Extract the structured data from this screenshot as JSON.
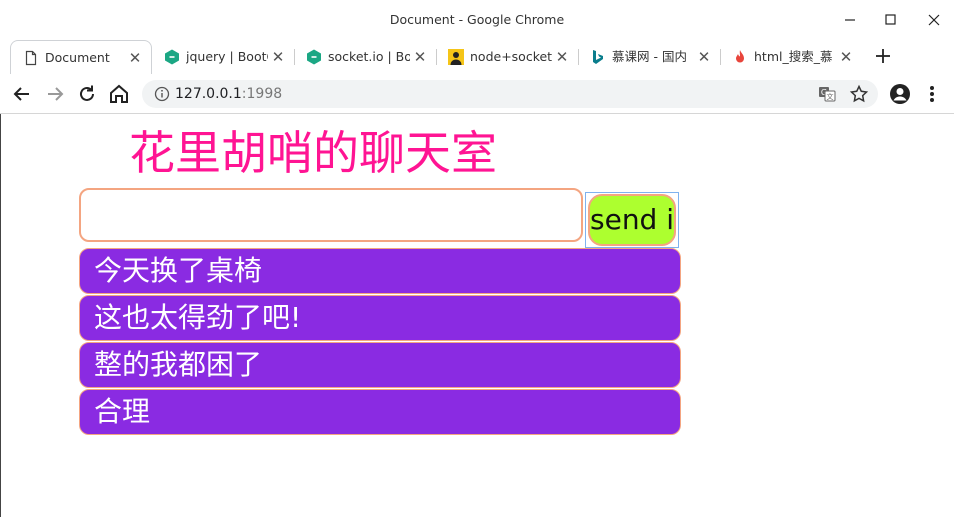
{
  "window": {
    "title": "Document - Google Chrome",
    "controls": [
      "minimize",
      "maximize",
      "close"
    ]
  },
  "tabs": [
    {
      "label": "Document",
      "icon": "document-icon",
      "active": true
    },
    {
      "label": "jquery | BootC",
      "icon": "bootcdn-icon",
      "active": false
    },
    {
      "label": "socket.io | Bo",
      "icon": "bootcdn-icon",
      "active": false
    },
    {
      "label": "node+socket",
      "icon": "avatar-icon",
      "active": false
    },
    {
      "label": "慕课网 - 国内",
      "icon": "bing-icon",
      "active": false
    },
    {
      "label": "html_搜索_慕",
      "icon": "fire-icon",
      "active": false
    }
  ],
  "toolbar": {
    "url_host": "127.0.0.1",
    "url_port": ":1998"
  },
  "page": {
    "title": "花里胡哨的聊天室",
    "input_value": "",
    "send_label": "send it",
    "messages": [
      "今天换了桌椅",
      "这也太得劲了吧!",
      "整的我都困了",
      "合理"
    ]
  },
  "colors": {
    "title": "#ff1493",
    "message_bg": "#8a2be2",
    "send_bg": "#adff2f",
    "border_accent": "#f4a581"
  }
}
